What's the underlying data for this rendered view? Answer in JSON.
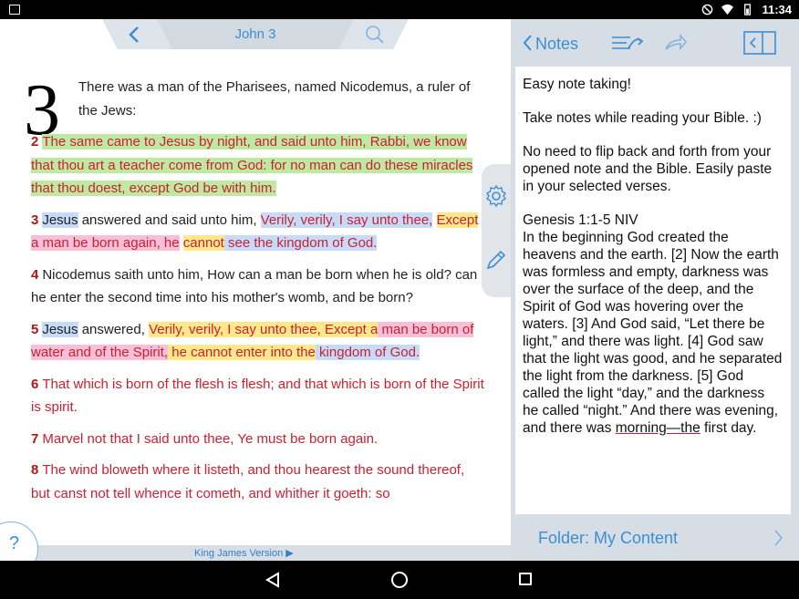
{
  "status_bar": {
    "time": "11:34"
  },
  "reader": {
    "chapter_title": "John 3",
    "chapter_number": "3",
    "version_label": "King James Version ▶",
    "help_label": "?",
    "verses": {
      "v1_text": "There was a man of the Pharisees, named Nicodemus, a ruler of the Jews:",
      "v2_num": "2",
      "v2_text": "The same came to Jesus by night, and said unto him, Rabbi, we know that thou art a teacher come from God: for no man can do these miracles that thou doest, except God be with him.",
      "v3_num": "3",
      "v3_a": "Jesus",
      "v3_b": " answered and said unto him, ",
      "v3_c": "Verily, verily, I say unto thee,",
      "v3_d": "Except",
      "v3_e": " a man be born again, he",
      "v3_f": "cannot",
      "v3_g": " see the kingdom of God.",
      "v4_num": "4",
      "v4_text": "Nicodemus saith unto him, How can a man be born when he is old? can he enter the second time into his mother's womb, and be born?",
      "v5_num": "5",
      "v5_a": "Jesus",
      "v5_b": " answered, ",
      "v5_c": "Verily, verily, I say unto thee, Except a",
      "v5_d": " man be born of water and of the Spirit,",
      "v5_e": " he cannot enter into the",
      "v5_f": " kingdom of God.",
      "v6_num": "6",
      "v6_text": "That which is born of the flesh is flesh; and that which is born of the Spirit is spirit.",
      "v7_num": "7",
      "v7_text": "Marvel not that I said unto thee, Ye must be born again.",
      "v8_num": "8",
      "v8_text": "The wind bloweth where it listeth, and thou hearest the sound thereof, but canst not tell whence it cometh, and whither it goeth: so"
    }
  },
  "notes": {
    "title": "Notes",
    "p1": "Easy note taking!",
    "p2": "Take notes while reading your Bible. :)",
    "p3": "No need to flip back and forth from your opened note and the Bible. Easily paste in your selected verses.",
    "p4_ref": "Genesis 1:1-5 NIV",
    "p4_text_a": "In the beginning God created the heavens and the earth. [2] Now the earth was formless and empty, darkness was over the surface of the deep, and the Spirit of God was hovering over the waters. [3] And God said, “Let there be light,” and there was light. [4] God saw that the light was good, and he separated the light from the darkness. [5] God called the light “day,” and the darkness he called “night.” And there was evening, and there was ",
    "p4_underlined": "morning—the",
    "p4_text_b": " first day.",
    "folder_label": "Folder: My Content"
  },
  "colors": {
    "accent_blue": "#3b8fd6",
    "verse_red": "#cc1f2f",
    "highlight_green": "#bfe8a2",
    "highlight_blue": "#c6dbf7",
    "highlight_yellow": "#fde98b",
    "highlight_pink": "#f7c0d8"
  },
  "icons": [
    "image-icon",
    "dnd-icon",
    "wifi-icon",
    "battery-icon",
    "back-chevron-icon",
    "search-icon",
    "gear-icon",
    "pencil-icon",
    "sync-icon",
    "share-icon",
    "panel-icon",
    "chevron-right-icon",
    "nav-back-icon",
    "nav-home-icon",
    "nav-recent-icon"
  ]
}
